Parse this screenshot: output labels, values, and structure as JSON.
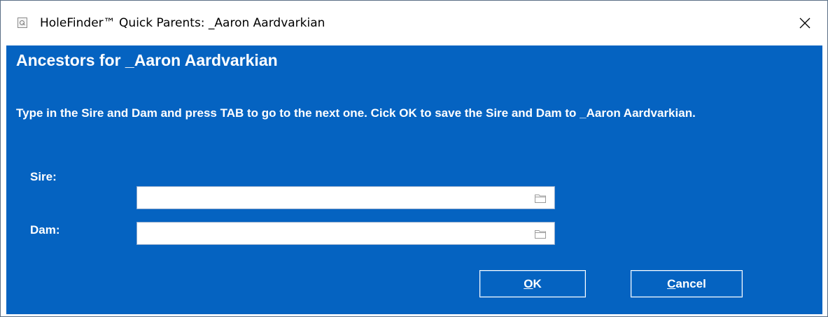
{
  "window": {
    "title": "HoleFinder™ Quick Parents: _Aaron Aardvarkian",
    "close_symbol": "✕"
  },
  "dialog": {
    "heading": "Ancestors for _Aaron Aardvarkian",
    "instructions_prefix": "Type in the Sire and Dam and press TAB to go to the next one. Cick OK to save the Sire and Dam to ",
    "instructions_name": "_Aaron Aardvarkian",
    "instructions_suffix": "."
  },
  "fields": {
    "sire": {
      "label": "Sire:",
      "value": "",
      "icon": "folder-icon"
    },
    "dam": {
      "label": "Dam:",
      "value": "",
      "icon": "folder-icon"
    }
  },
  "buttons": {
    "ok_mnemonic": "O",
    "ok_rest": "K",
    "cancel_mnemonic": "C",
    "cancel_rest": "ancel"
  },
  "colors": {
    "client_background": "#0563c1",
    "title_background": "#ffffff",
    "text_on_client": "#ffffff"
  }
}
